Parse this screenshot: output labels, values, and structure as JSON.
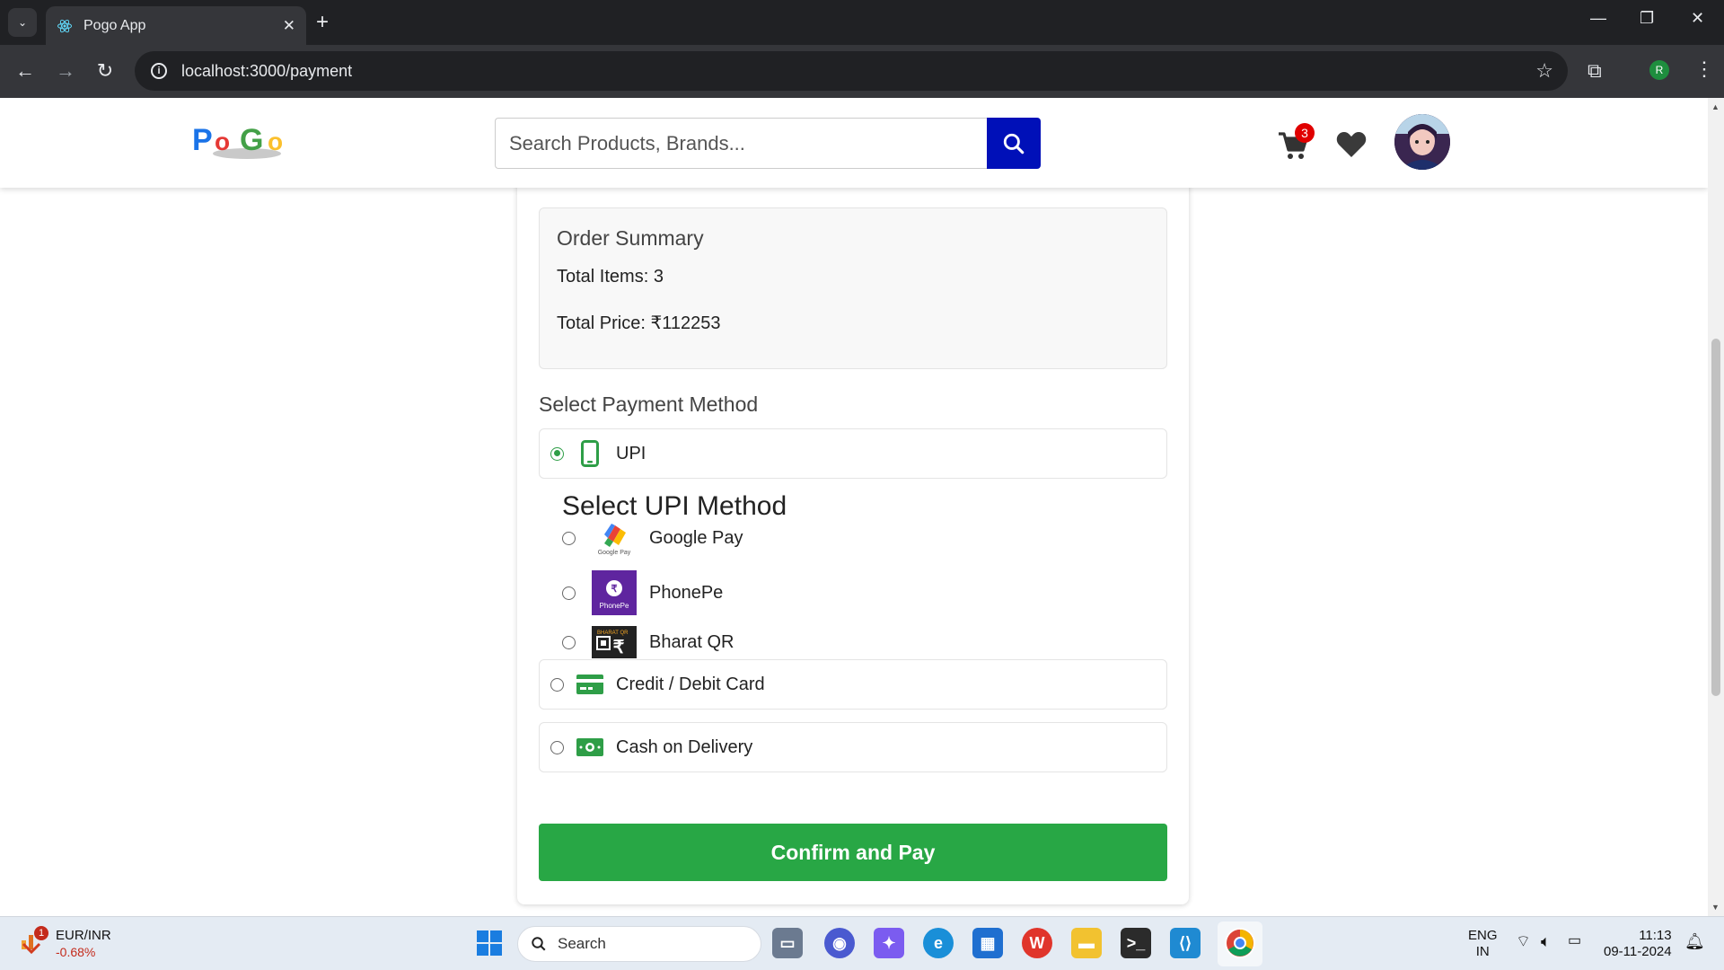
{
  "browser": {
    "tab_title": "Pogo App",
    "tab_close": "✕",
    "new_tab": "+",
    "url": "localhost:3000/payment",
    "profile_initial": "R",
    "window_controls": [
      "—",
      "❐",
      "✕"
    ]
  },
  "header": {
    "search_placeholder": "Search Products, Brands...",
    "cart_count": "3"
  },
  "summary": {
    "title": "Order Summary",
    "total_items": "Total Items: 3",
    "total_price": "Total Price: ₹112253"
  },
  "payment": {
    "title": "Select Payment Method",
    "options": [
      {
        "label": "UPI",
        "selected": true,
        "icon": "phone-icon"
      },
      {
        "label": "Credit / Debit Card",
        "selected": false,
        "icon": "credit-card-icon"
      },
      {
        "label": "Cash on Delivery",
        "selected": false,
        "icon": "cash-icon"
      }
    ],
    "upi_title": "Select UPI Method",
    "upi_methods": [
      {
        "label": "Google Pay",
        "logo_text": "Google Pay"
      },
      {
        "label": "PhonePe",
        "logo_text": "PhonePe"
      },
      {
        "label": "Bharat QR",
        "logo_text": "BHARAT QR"
      }
    ],
    "confirm_label": "Confirm and Pay"
  },
  "taskbar": {
    "widget_badge": "1",
    "widget_title": "EUR/INR",
    "widget_value": "-0.68%",
    "search_label": "Search",
    "lang_line1": "ENG",
    "lang_line2": "IN",
    "time": "11:13",
    "date": "09-11-2024"
  },
  "colors": {
    "accent_green": "#28a745",
    "search_button": "#0010b8",
    "badge_red": "#e00000"
  }
}
